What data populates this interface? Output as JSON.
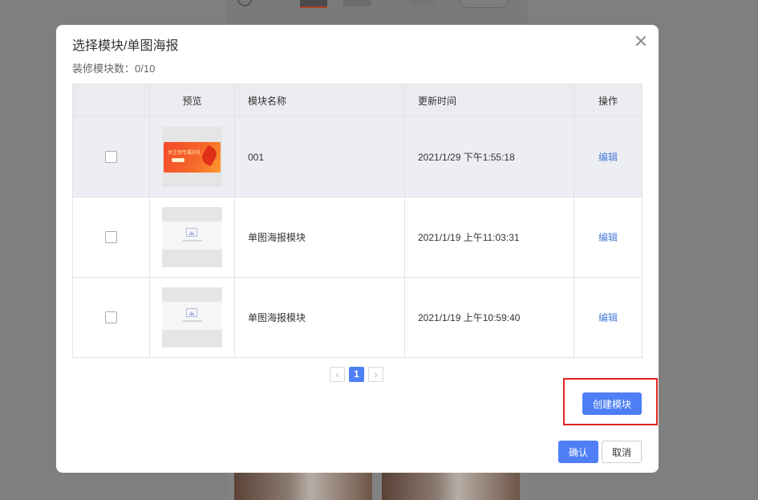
{
  "modal": {
    "title": "选择模块/单图海报",
    "count_label": "装修模块数：0/10"
  },
  "table": {
    "headers": {
      "select": "",
      "preview": "预览",
      "name": "模块名称",
      "updated": "更新时间",
      "actions": "操作"
    },
    "rows": [
      {
        "name": "001",
        "updated": "2021/1/29 下午1:55:18",
        "action": "编辑",
        "thumb_text": "关注领专属好礼"
      },
      {
        "name": "单图海报模块",
        "updated": "2021/1/19 上午11:03:31",
        "action": "编辑"
      },
      {
        "name": "单图海报模块",
        "updated": "2021/1/19 上午10:59:40",
        "action": "编辑"
      }
    ]
  },
  "pagination": {
    "prev": "‹",
    "current": "1",
    "next": "›"
  },
  "buttons": {
    "create": "创建模块",
    "confirm": "确认",
    "cancel": "取消"
  },
  "colors": {
    "accent": "#4e7ff7",
    "link": "#4a7cd8",
    "highlight_box": "#e32222",
    "header_bg": "#ebecf0"
  }
}
